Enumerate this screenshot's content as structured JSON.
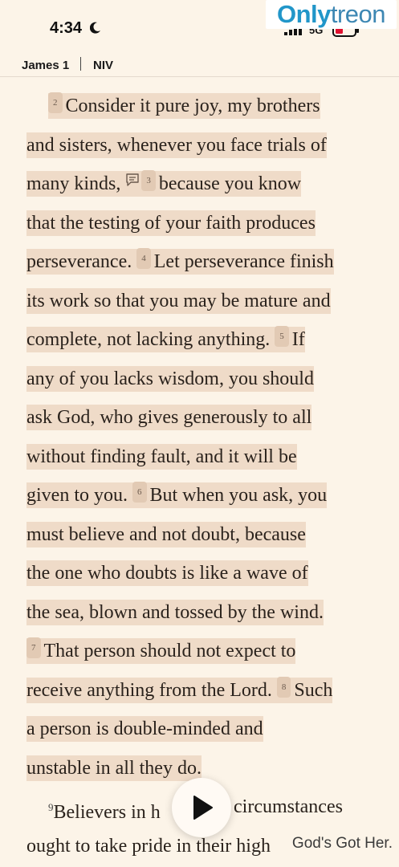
{
  "status": {
    "time": "4:34",
    "network": "5G"
  },
  "watermark": {
    "part1": "Only",
    "part2": "treon"
  },
  "nav": {
    "chapter": "James 1",
    "version": "NIV"
  },
  "passage": {
    "lines": [
      {
        "verse": "2",
        "text": "Consider it pure joy, my brothers"
      },
      {
        "text": "and sisters, whenever you face trials of"
      },
      {
        "pre": "many kinds,",
        "verse": "3",
        "text": "because you know"
      },
      {
        "text": "that the testing of your faith produces"
      },
      {
        "pre": "perseverance.",
        "verse": "4",
        "text": "Let perseverance finish"
      },
      {
        "text": "its work so that you may be mature and"
      },
      {
        "pre": "complete, not lacking anything.",
        "verse": "5",
        "text": "If"
      },
      {
        "text": "any of you lacks wisdom, you should"
      },
      {
        "text": "ask God, who gives generously to all"
      },
      {
        "text": "without finding fault, and it will be"
      },
      {
        "pre": "given to you.",
        "verse": "6",
        "text": "But when you ask, you"
      },
      {
        "text": "must believe and not doubt, because"
      },
      {
        "text": "the one who doubts is like a wave of"
      },
      {
        "text": "the sea, blown and tossed by the wind."
      },
      {
        "verse": "7",
        "text": "That person should not expect to"
      },
      {
        "pre": "receive anything from the Lord.",
        "verse": "8",
        "text": "Such"
      },
      {
        "text": "a person is double-minded and"
      },
      {
        "text": "unstable in all they do."
      }
    ],
    "unhighlighted": [
      {
        "verse": "9",
        "left": "Believers in h",
        "right": "circumstances"
      },
      {
        "text": "ought to take pride in their high"
      }
    ]
  },
  "credit": "God's Got Her."
}
